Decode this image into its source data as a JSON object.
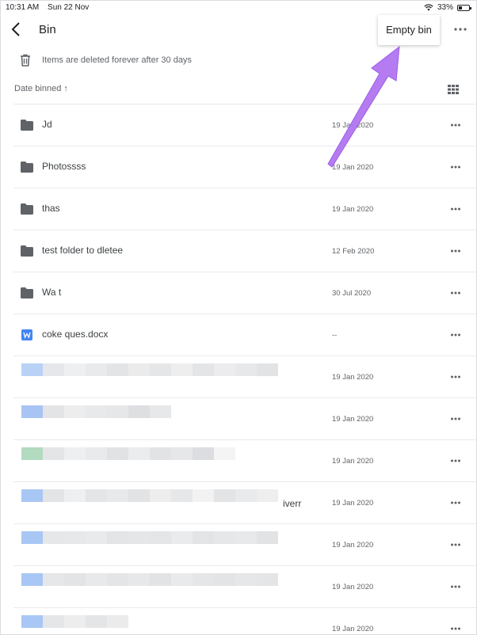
{
  "status": {
    "time": "10:31 AM",
    "date": "Sun 22 Nov",
    "battery": "33%",
    "battery_level": 0.33
  },
  "appbar": {
    "title": "Bin",
    "menu_item": "Empty bin"
  },
  "notice": {
    "text": "Items are deleted forever after 30 days"
  },
  "sort": {
    "label": "Date binned ↑"
  },
  "items": [
    {
      "type": "folder",
      "name": "Jd",
      "date": "19 Jan 2020"
    },
    {
      "type": "folder",
      "name": "Photossss",
      "date": "19 Jan 2020"
    },
    {
      "type": "folder",
      "name": "thas",
      "date": "19 Jan 2020"
    },
    {
      "type": "folder",
      "name": "test folder to dletee",
      "date": "12 Feb 2020"
    },
    {
      "type": "folder",
      "name": "Wa t",
      "date": "30 Jul 2020"
    },
    {
      "type": "doc",
      "name": "coke ques.docx",
      "date": "--"
    },
    {
      "type": "redacted",
      "date": "19 Jan 2020"
    },
    {
      "type": "redacted",
      "date": "19 Jan 2020"
    },
    {
      "type": "redacted",
      "date": "19 Jan 2020"
    },
    {
      "type": "redacted",
      "tail": "iverr",
      "date": "19 Jan 2020"
    },
    {
      "type": "redacted",
      "date": "19 Jan 2020"
    },
    {
      "type": "redacted",
      "date": "19 Jan 2020"
    },
    {
      "type": "redacted",
      "date": "19 Jan 2020"
    }
  ],
  "colors": {
    "folder": "#5f6368",
    "doc": "#4285f4",
    "annotation_arrow": "#b57cf2"
  }
}
